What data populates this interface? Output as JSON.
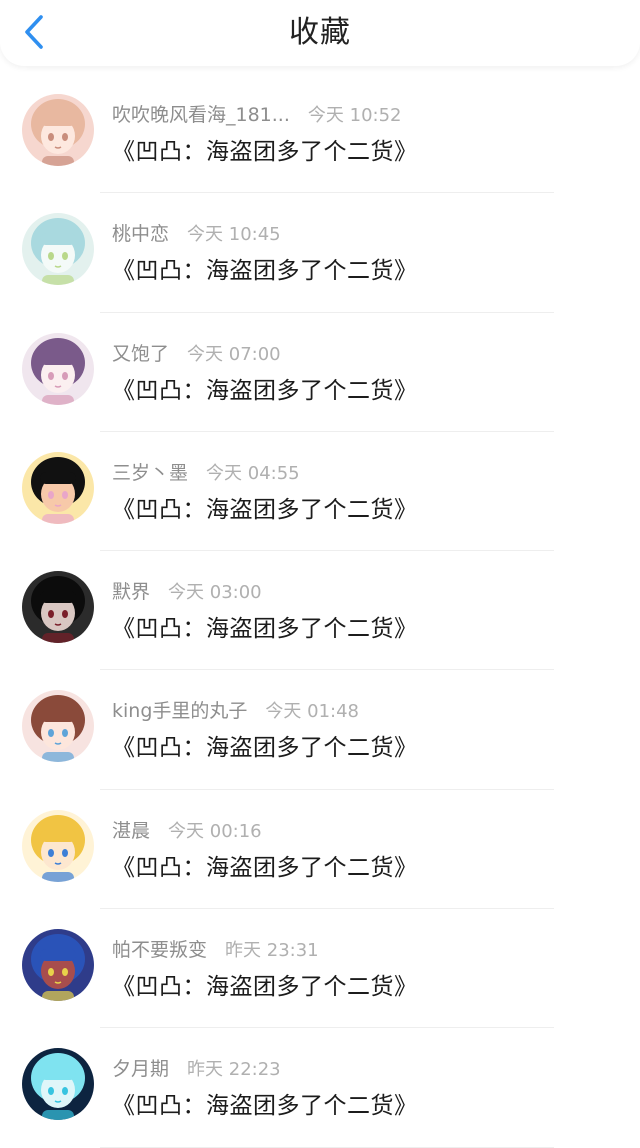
{
  "header": {
    "title": "收藏",
    "back_icon": "chevron-left-icon",
    "accent_color": "#2f8ff0"
  },
  "items": [
    {
      "name": "吹吹晚风看海_181...",
      "time": "今天 10:52",
      "message": "《凹凸：海盗团多了个二货》",
      "avatar": {
        "bg": "#f6d7cf",
        "hair": "#e8b8a0",
        "face": "#fde8df",
        "accent": "#c98d7c"
      }
    },
    {
      "name": "桃中恋",
      "time": "今天 10:45",
      "message": "《凹凸：海盗团多了个二货》",
      "avatar": {
        "bg": "#e3f1ee",
        "hair": "#a9d9df",
        "face": "#f4faf8",
        "accent": "#b9d88a"
      }
    },
    {
      "name": "又饱了",
      "time": "今天 07:00",
      "message": "《凹凸：海盗团多了个二货》",
      "avatar": {
        "bg": "#f0e6ee",
        "hair": "#7a5a8a",
        "face": "#fbeff0",
        "accent": "#d79bb8"
      }
    },
    {
      "name": "三岁丶墨",
      "time": "今天 04:55",
      "message": "《凹凸：海盗团多了个二货》",
      "avatar": {
        "bg": "#fbe7a8",
        "hair": "#111111",
        "face": "#f7c9a9",
        "accent": "#e9a6c9"
      }
    },
    {
      "name": "默界",
      "time": "今天 03:00",
      "message": "《凹凸：海盗团多了个二货》",
      "avatar": {
        "bg": "#2b2b2b",
        "hair": "#0c0c0c",
        "face": "#d9c7c2",
        "accent": "#7a1f2a"
      }
    },
    {
      "name": "king手里的丸子",
      "time": "今天 01:48",
      "message": "《凹凸：海盗团多了个二货》",
      "avatar": {
        "bg": "#f7e3e0",
        "hair": "#8a4a3a",
        "face": "#fde6dc",
        "accent": "#5fa4d8"
      }
    },
    {
      "name": "湛晨",
      "time": "今天 00:16",
      "message": "《凹凸：海盗团多了个二货》",
      "avatar": {
        "bg": "#fff3d6",
        "hair": "#f1c443",
        "face": "#fde7cf",
        "accent": "#3d7fd6"
      }
    },
    {
      "name": "帕不要叛变",
      "time": "昨天 23:31",
      "message": "《凹凸：海盗团多了个二货》",
      "avatar": {
        "bg": "#2f3c8a",
        "hair": "#2a53b8",
        "face": "#a84d4d",
        "accent": "#e8d24a"
      }
    },
    {
      "name": "夕月期",
      "time": "昨天 22:23",
      "message": "《凹凸：海盗团多了个二货》",
      "avatar": {
        "bg": "#0d2440",
        "hair": "#7fe3f0",
        "face": "#dff6f9",
        "accent": "#37c4e0"
      }
    }
  ]
}
